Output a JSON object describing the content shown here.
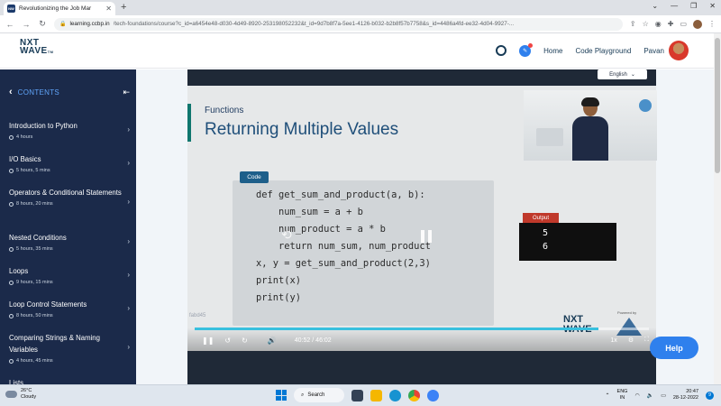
{
  "browser": {
    "tab_title": "Revolutionizing the Job Mar",
    "tab_close": "✕",
    "new_tab": "+",
    "url_host": "learning.ccbp.in",
    "url_path": "/tech-foundations/course?c_id=a6454e48-d030-4d49-8920-253198052232&t_id=9d7b8f7a-5ee1-4126-b032-b2b8f57b7758&s_id=4486a4fd-ee32-4d04-9927-...",
    "favicon_label": "NW"
  },
  "header": {
    "logo_line1": "NXT",
    "logo_line2": "WAVE",
    "logo_tm": "TM",
    "home": "Home",
    "code_playground": "Code Playground",
    "user_name": "Pavan"
  },
  "sidebar": {
    "heading": "CONTENTS",
    "items": [
      {
        "title": "Introduction to Python",
        "duration": "4 hours"
      },
      {
        "title": "I/O Basics",
        "duration": "5 hours, 5 mins"
      },
      {
        "title": "Operators & Conditional Statements",
        "duration": "8 hours, 20 mins"
      },
      {
        "title": "Nested Conditions",
        "duration": "5 hours, 35 mins"
      },
      {
        "title": "Loops",
        "duration": "9 hours, 15 mins"
      },
      {
        "title": "Loop Control Statements",
        "duration": "8 hours, 50 mins"
      },
      {
        "title": "Comparing Strings & Naming Variables",
        "duration": "4 hours, 45 mins"
      },
      {
        "title": "Lists",
        "duration": ""
      }
    ]
  },
  "video": {
    "language": "English",
    "slide_subtitle": "Functions",
    "slide_title": "Returning Multiple Values",
    "code_tag": "Code",
    "code_lines": [
      "def get_sum_and_product(a, b):",
      "    num_sum = a + b",
      "    num_product = a * b",
      "    return num_sum, num_product",
      "",
      "x, y = get_sum_and_product(2,3)",
      "print(x)",
      "print(y)"
    ],
    "output_tag": "Output",
    "output_lines": [
      "5",
      "6"
    ],
    "watermark": "fabd45",
    "brand_line1": "NXT",
    "brand_line2": "WAVE",
    "powered_by": "Powered by",
    "current_time": "40:52",
    "separator": "/",
    "total_time": "46:02",
    "progress": 0.888,
    "speed": "1x"
  },
  "help": "Help",
  "taskbar": {
    "temperature": "26°C",
    "weather": "Cloudy",
    "search": "Search",
    "lang_line1": "ENG",
    "lang_line2": "IN",
    "time": "20:47",
    "date": "28-12-2022",
    "notif_count": "9"
  },
  "colors": {
    "sidebar_bg": "#1b2a4a",
    "accent": "#2f80ed",
    "progress": "#39c0de"
  }
}
